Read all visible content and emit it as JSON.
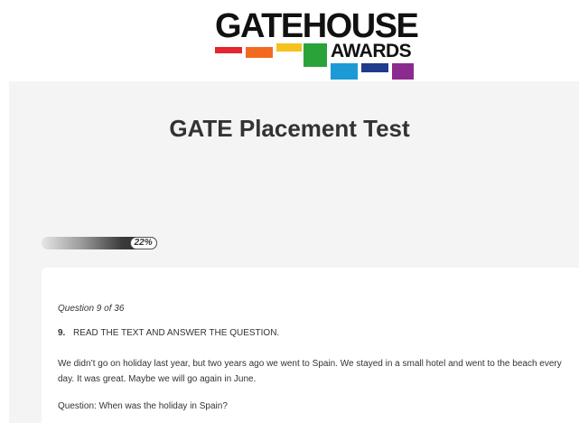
{
  "logo": {
    "line1": "GATEHOUSE",
    "line2": "AWARDS",
    "colors": {
      "red": "#e3262f",
      "orange": "#f26a21",
      "yellow": "#f6c21b",
      "green": "#2aa33a",
      "light_blue": "#1b9ad6",
      "dark_blue": "#1f3b8c",
      "purple": "#8b2b8f"
    }
  },
  "header": {
    "title": "GATE Placement Test"
  },
  "progress": {
    "percent": 22,
    "label": "22%"
  },
  "question": {
    "counter": "Question 9 of 36",
    "number": "9.",
    "instruction": "READ THE TEXT AND ANSWER THE QUESTION.",
    "passage": "We didn’t go on holiday last year, but two years ago we went to Spain. We stayed in a small hotel and went to the beach every day. It was great. Maybe we will go again in June.",
    "prompt": "Question: When was the holiday in Spain?"
  }
}
